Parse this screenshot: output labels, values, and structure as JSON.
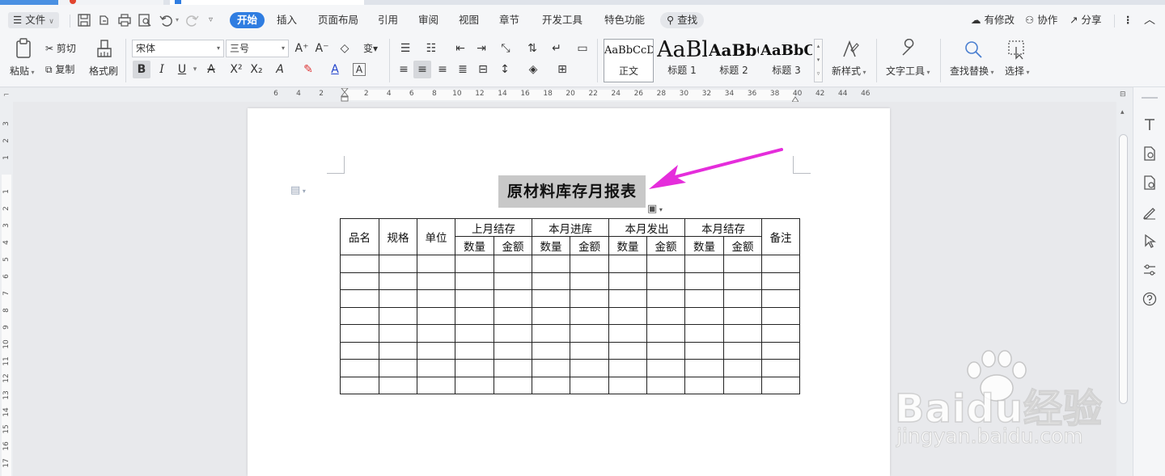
{
  "menubar": {
    "file_label": "文件",
    "tabs": [
      "开始",
      "插入",
      "页面布局",
      "引用",
      "审阅",
      "视图",
      "章节",
      "开发工具",
      "特色功能"
    ],
    "active_tab": "开始",
    "search_label": "查找",
    "right": {
      "changes": "有修改",
      "collab": "协作",
      "share": "分享"
    }
  },
  "ribbon": {
    "paste": "粘贴",
    "cut": "剪切",
    "copy": "复制",
    "format_painter": "格式刷",
    "font_name": "宋体",
    "font_size": "三号",
    "bold": "B",
    "italic": "I",
    "underline": "U",
    "styles": [
      {
        "sample": "AaBbCcDc",
        "name": "正文"
      },
      {
        "sample": "AaBl",
        "name": "标题 1"
      },
      {
        "sample": "AaBbC",
        "name": "标题 2"
      },
      {
        "sample": "AaBbC",
        "name": "标题 3"
      }
    ],
    "new_style": "新样式",
    "text_tools": "文字工具",
    "find_replace": "查找替换",
    "select": "选择"
  },
  "ruler": {
    "h_numbers": [
      "6",
      "4",
      "2",
      "2",
      "4",
      "6",
      "8",
      "10",
      "12",
      "14",
      "16",
      "18",
      "20",
      "22",
      "24",
      "26",
      "28",
      "30",
      "32",
      "34",
      "36",
      "38",
      "40",
      "42",
      "44",
      "46"
    ],
    "v_numbers": [
      "3",
      "2",
      "1",
      "1",
      "2",
      "3",
      "4",
      "5",
      "6",
      "7",
      "8",
      "9",
      "10",
      "11",
      "12",
      "13",
      "14",
      "15",
      "16",
      "17"
    ]
  },
  "document": {
    "title": "原材料库存月报表",
    "table": {
      "col1": "品名",
      "col2": "规格",
      "col3": "单位",
      "groups": [
        "上月结存",
        "本月进库",
        "本月发出",
        "本月结存"
      ],
      "sub_qty": "数量",
      "sub_amt": "金额",
      "remark": "备注",
      "empty_rows": 8
    }
  },
  "watermark": {
    "logo": "Baidu经验",
    "url": "jingyan.baidu.com"
  },
  "colors": {
    "accent": "#2f7de1",
    "arrow": "#e52ddb"
  }
}
